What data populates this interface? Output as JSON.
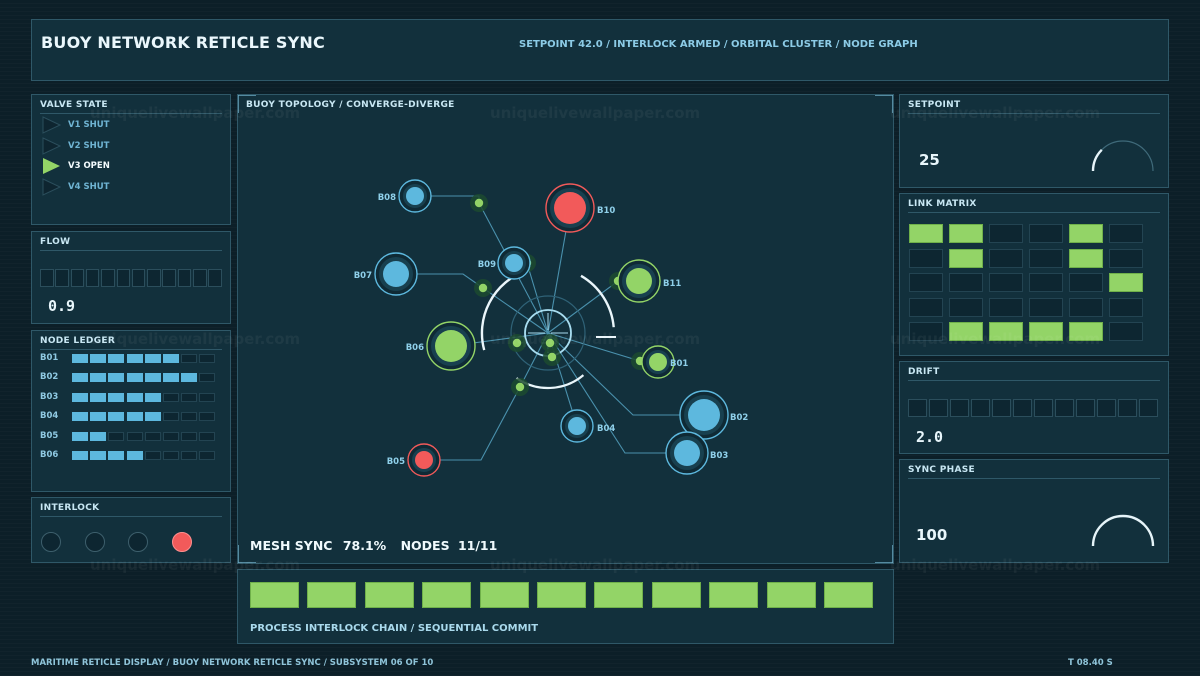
{
  "header": {
    "title": "BUOY NETWORK RETICLE SYNC",
    "status": "SETPOINT 42.0 / INTERLOCK ARMED / ORBITAL CLUSTER / NODE GRAPH"
  },
  "valve_state": {
    "title": "VALVE STATE",
    "items": [
      {
        "label": "V1 SHUT",
        "open": false
      },
      {
        "label": "V2 SHUT",
        "open": false
      },
      {
        "label": "V3 OPEN",
        "open": true
      },
      {
        "label": "V4 SHUT",
        "open": false
      }
    ]
  },
  "flow": {
    "title": "FLOW",
    "value": "0.9",
    "segments_total": 12
  },
  "node_ledger": {
    "title": "NODE LEDGER",
    "rows": [
      {
        "label": "B01",
        "fill": 6
      },
      {
        "label": "B02",
        "fill": 7
      },
      {
        "label": "B03",
        "fill": 5
      },
      {
        "label": "B04",
        "fill": 5
      },
      {
        "label": "B05",
        "fill": 2
      },
      {
        "label": "B06",
        "fill": 4
      }
    ],
    "total": 8
  },
  "interlock": {
    "title": "INTERLOCK",
    "lights": [
      false,
      false,
      false,
      true
    ]
  },
  "topology": {
    "title": "BUOY TOPOLOGY / CONVERGE-DIVERGE",
    "sync_label": "MESH SYNC",
    "sync_value": "78.1%",
    "nodes_label": "NODES",
    "nodes_value": "11/11"
  },
  "chain": {
    "caption": "PROCESS INTERLOCK CHAIN / SEQUENTIAL COMMIT",
    "blocks": 11
  },
  "setpoint": {
    "title": "SETPOINT",
    "value": "25",
    "level": 0.25
  },
  "link_matrix": {
    "title": "LINK MATRIX",
    "rows": [
      [
        1,
        1,
        0,
        0,
        1,
        0
      ],
      [
        0,
        1,
        0,
        0,
        1,
        0
      ],
      [
        0,
        0,
        0,
        0,
        0,
        1
      ],
      [
        0,
        0,
        0,
        0,
        0,
        0
      ],
      [
        0,
        1,
        1,
        1,
        1,
        0
      ]
    ]
  },
  "drift": {
    "title": "DRIFT",
    "value": "2.0",
    "segments_total": 12
  },
  "sync_phase": {
    "title": "SYNC PHASE",
    "value": "100",
    "level": 1.0
  },
  "footer": {
    "left": "MARITIME RETICLE DISPLAY / BUOY NETWORK RETICLE SYNC / SUBSYSTEM 06 OF 10",
    "right": "T 08.40 S"
  },
  "watermark": "uniquelivewallpaper.com",
  "graph_nodes": [
    {
      "id": "B01",
      "type": "green",
      "size": "small"
    },
    {
      "id": "B02",
      "type": "blue",
      "size": "large"
    },
    {
      "id": "B03",
      "type": "blue",
      "size": "medium"
    },
    {
      "id": "B04",
      "type": "blue",
      "size": "small"
    },
    {
      "id": "B05",
      "type": "red",
      "size": "small"
    },
    {
      "id": "B06",
      "type": "green",
      "size": "large"
    },
    {
      "id": "B07",
      "type": "blue",
      "size": "medium"
    },
    {
      "id": "B08",
      "type": "blue",
      "size": "small"
    },
    {
      "id": "B09",
      "type": "blue",
      "size": "small"
    },
    {
      "id": "B10",
      "type": "red",
      "size": "large"
    },
    {
      "id": "B11",
      "type": "green",
      "size": "medium"
    }
  ],
  "colors": {
    "blue": "#5db8de",
    "green": "#93d467",
    "red": "#f25a5a",
    "panel": "#12303c",
    "border": "#2f5868"
  }
}
